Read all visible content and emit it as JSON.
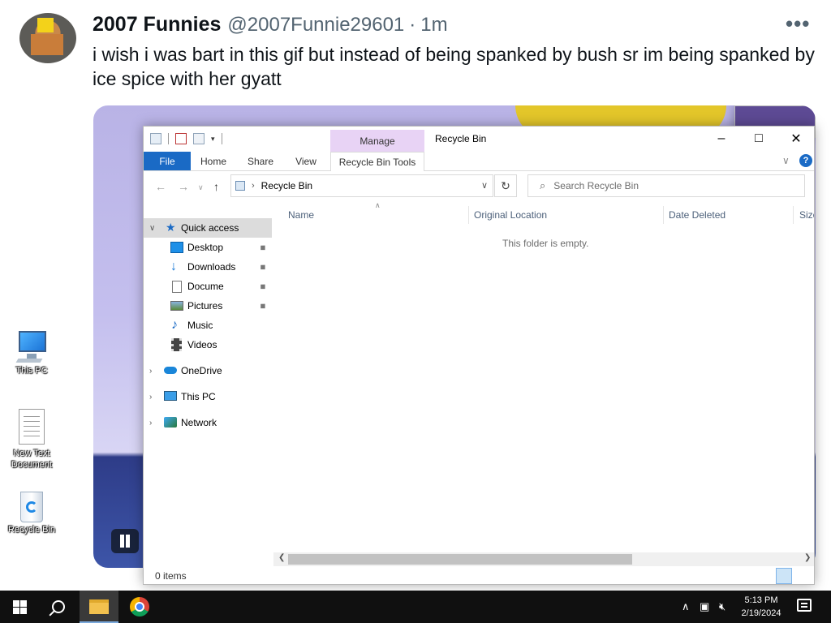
{
  "tweet": {
    "name": "2007 Funnies",
    "handle": "@2007Funnie29601",
    "separator": "·",
    "time": "1m",
    "more": "•••",
    "text": "i wish i was bart in this gif but instead of being spanked by bush sr im being spanked by ice spice with her gyatt",
    "playback": "paused"
  },
  "desktop": {
    "icons": [
      {
        "label": "This PC",
        "icon": "computer-icon"
      },
      {
        "label": "New Text Document",
        "icon": "text-document-icon"
      },
      {
        "label": "Recycle Bin",
        "icon": "recycle-bin-icon"
      }
    ]
  },
  "explorer": {
    "title": "Recycle Bin",
    "manage_tab": "Manage",
    "ribbon_tabs": [
      "File",
      "Home",
      "Share",
      "View",
      "Recycle Bin Tools"
    ],
    "address_path": [
      "Recycle Bin"
    ],
    "search_placeholder": "Search Recycle Bin",
    "nav": {
      "quick_access": "Quick access",
      "quick_items": [
        "Desktop",
        "Downloads",
        "Docume",
        "Pictures",
        "Music",
        "Videos"
      ],
      "roots": [
        "OneDrive",
        "This PC",
        "Network"
      ]
    },
    "columns": [
      "Name",
      "Original Location",
      "Date Deleted",
      "Size"
    ],
    "empty_message": "This folder is empty.",
    "status": "0 items",
    "colors": {
      "accent": "#1a6ac5",
      "manage_tab": "#e8d3f5",
      "selection": "#dcdcdc"
    }
  },
  "taskbar": {
    "apps": [
      "start",
      "search",
      "file-explorer",
      "chrome"
    ],
    "active_app": "file-explorer",
    "clock_time": "5:13 PM",
    "clock_date": "2/19/2024"
  }
}
